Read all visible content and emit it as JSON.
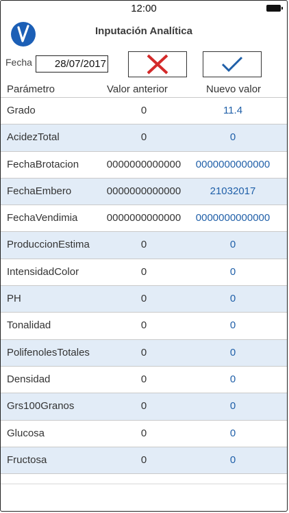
{
  "status_bar": {
    "time": "12:00"
  },
  "header": {
    "title": "Inputación Analítica"
  },
  "date": {
    "label": "Fecha",
    "value": "28/07/2017"
  },
  "buttons": {
    "cancel_icon": "close-x-icon",
    "accept_icon": "checkmark-icon"
  },
  "colors": {
    "accent": "#1f5fa8",
    "logo": "#1c5fb6",
    "cancel": "#d42a2a",
    "row_alt": "#e2ecf7"
  },
  "columns": {
    "param": "Parámetro",
    "old": "Valor anterior",
    "new": "Nuevo valor"
  },
  "rows": [
    {
      "param": "Grado",
      "old": "0",
      "new": "11.4"
    },
    {
      "param": "AcidezTotal",
      "old": "0",
      "new": "0"
    },
    {
      "param": "FechaBrotacion",
      "old": "0000000000000",
      "new": "0000000000000"
    },
    {
      "param": "FechaEmbero",
      "old": "0000000000000",
      "new": "21032017"
    },
    {
      "param": "FechaVendimia",
      "old": "0000000000000",
      "new": "0000000000000"
    },
    {
      "param": "ProduccionEstima",
      "old": "0",
      "new": "0"
    },
    {
      "param": "IntensidadColor",
      "old": "0",
      "new": "0"
    },
    {
      "param": "PH",
      "old": "0",
      "new": "0"
    },
    {
      "param": "Tonalidad",
      "old": "0",
      "new": "0"
    },
    {
      "param": "PolifenolesTotales",
      "old": "0",
      "new": "0"
    },
    {
      "param": "Densidad",
      "old": "0",
      "new": "0"
    },
    {
      "param": "Grs100Granos",
      "old": "0",
      "new": "0"
    },
    {
      "param": "Glucosa",
      "old": "0",
      "new": "0"
    },
    {
      "param": "Fructosa",
      "old": "0",
      "new": "0"
    }
  ]
}
